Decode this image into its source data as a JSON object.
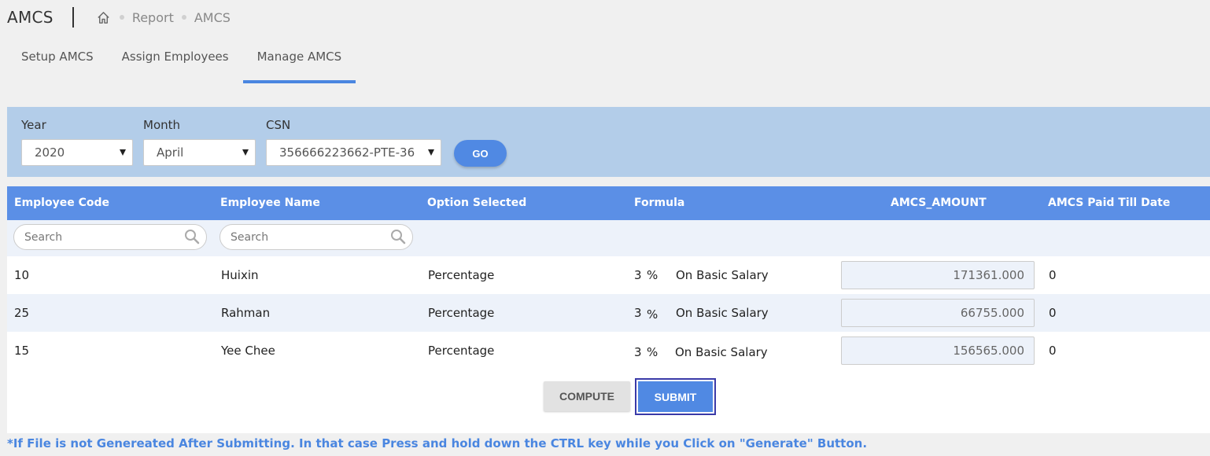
{
  "header": {
    "title": "AMCS",
    "breadcrumb": [
      "Report",
      "AMCS"
    ]
  },
  "tabs": [
    {
      "label": "Setup AMCS"
    },
    {
      "label": "Assign Employees"
    },
    {
      "label": "Manage AMCS",
      "active": true
    }
  ],
  "filters": {
    "year": {
      "label": "Year",
      "value": "2020"
    },
    "month": {
      "label": "Month",
      "value": "April"
    },
    "csn": {
      "label": "CSN",
      "value": "356666223662-PTE-36"
    },
    "go_label": "GO"
  },
  "table": {
    "columns": [
      "Employee Code",
      "Employee Name",
      "Option Selected",
      "Formula",
      "AMCS_AMOUNT",
      "AMCS Paid Till Date"
    ],
    "search_placeholder": "Search",
    "rows": [
      {
        "code": "10",
        "name": "Huixin",
        "option": "Percentage",
        "rate": "3",
        "unit": "%",
        "basis": "On Basic Salary",
        "amount": "171361.000",
        "paid": "0"
      },
      {
        "code": "25",
        "name": "Rahman",
        "option": "Percentage",
        "rate": "3",
        "unit": "%",
        "basis": "On Basic Salary",
        "amount": "66755.000",
        "paid": "0"
      },
      {
        "code": "15",
        "name": "Yee Chee",
        "option": "Percentage",
        "rate": "3",
        "unit": "%",
        "basis": "On Basic Salary",
        "amount": "156565.000",
        "paid": "0"
      }
    ]
  },
  "actions": {
    "compute_label": "COMPUTE",
    "submit_label": "SUBMIT"
  },
  "note": "*If File is not Genereated After Submitting. In that case Press and hold down the CTRL key while you Click on \"Generate\" Button.",
  "colors": {
    "accent": "#4a86e0",
    "header_bg": "#5b8fe6",
    "filter_bg": "#b3cde9"
  },
  "icons": {
    "home": "home-icon",
    "search": "search-icon",
    "dropdown": "caret-down-icon"
  }
}
